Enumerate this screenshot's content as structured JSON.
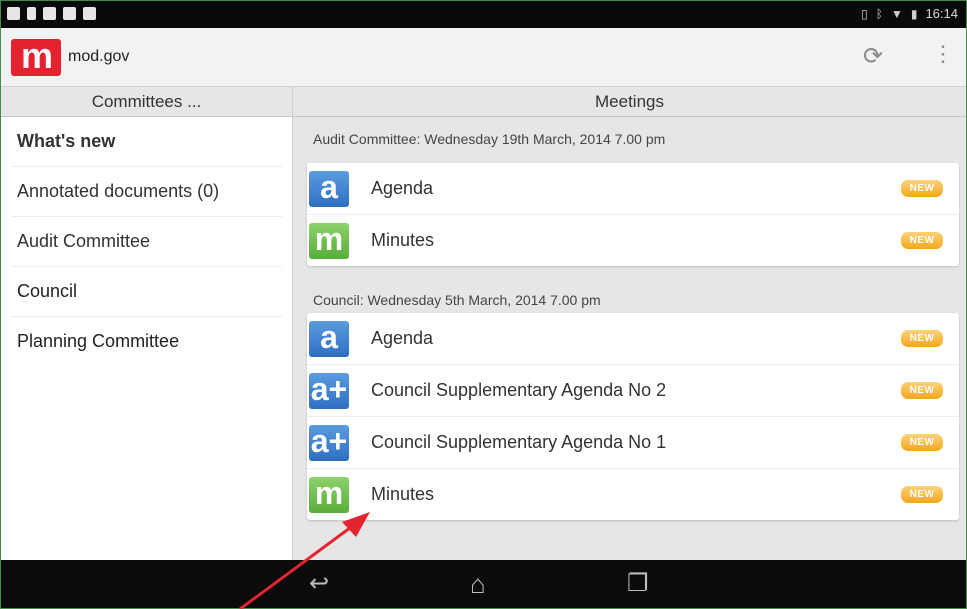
{
  "status_bar": {
    "time": "16:14",
    "icons": [
      "picture-icon",
      "battery-icon",
      "cloud-icon",
      "checkbox-icon",
      "download-icon"
    ],
    "right_icons": [
      "sim-icon",
      "bluetooth-icon",
      "wifi-icon",
      "battery-icon"
    ]
  },
  "app": {
    "title": "mod.gov",
    "logo_letter": "m",
    "actions": [
      "refresh-icon",
      "overflow-menu-icon"
    ]
  },
  "left_pane": {
    "header": "Committees ...",
    "items": [
      {
        "label": "What's new"
      },
      {
        "label": "Annotated documents (0)"
      },
      {
        "label": "Audit Committee"
      },
      {
        "label": "Council"
      },
      {
        "label": "Planning Committee"
      }
    ]
  },
  "right_pane": {
    "header": "Meetings",
    "groups": [
      {
        "label": "Audit Committee: Wednesday 19th March, 2014 7.00 pm",
        "docs": [
          {
            "icon": "a",
            "title": "Agenda",
            "badge": "NEW"
          },
          {
            "icon": "m",
            "title": "Minutes",
            "badge": "NEW"
          }
        ]
      },
      {
        "label": "Council: Wednesday 5th March, 2014 7.00 pm",
        "docs": [
          {
            "icon": "a",
            "title": "Agenda",
            "badge": "NEW"
          },
          {
            "icon": "a+",
            "title": "Council Supplementary Agenda No 2",
            "badge": "NEW"
          },
          {
            "icon": "a+",
            "title": "Council Supplementary Agenda No 1",
            "badge": "NEW"
          },
          {
            "icon": "m",
            "title": "Minutes",
            "badge": "NEW"
          }
        ]
      }
    ]
  },
  "nav_bar": {
    "buttons": [
      "back-icon",
      "home-icon",
      "recent-apps-icon"
    ]
  },
  "colors": {
    "logo": "#e52330",
    "agenda_icon": "#3a7fd0",
    "minutes_icon": "#6cc04a",
    "badge": "#f5a623",
    "annotation_arrow": "#e3252f"
  }
}
